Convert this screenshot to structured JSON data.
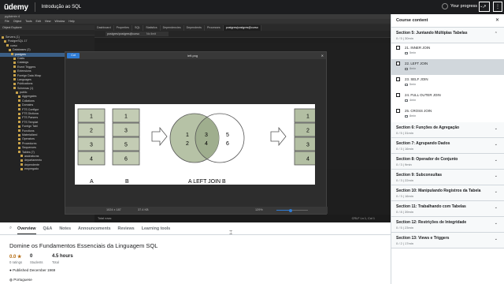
{
  "header": {
    "logo": "ūdemy",
    "course_title": "Introdução ao SQL",
    "progress_label": "Your progress",
    "share_icon": "share-icon",
    "more_icon": "more-icon"
  },
  "pgadmin": {
    "window_title": "pgAdmin 4",
    "menu": [
      "File",
      "Object",
      "Tools",
      "Edit",
      "View",
      "Window",
      "Help"
    ],
    "explorer_title": "Object Explorer",
    "tree": [
      "Servers (1)",
      "PostgreSQL 17",
      "curso",
      "Databases (2)",
      "postgres",
      "Casts",
      "Catalogs",
      "Event Triggers",
      "Extensions",
      "Foreign Data Wrap",
      "Languages",
      "Publications",
      "Schemas (1)",
      "public",
      "Aggregates",
      "Collations",
      "Domains",
      "FTS Configur",
      "FTS Dictiona",
      "FTS Parsers",
      "FTS Templat",
      "Foreign Tabl",
      "Functions",
      "Materialized",
      "Operators",
      "Procedures",
      "Sequences",
      "Tables (7)",
      "assinaturas",
      "departamento",
      "dependente",
      "empregado"
    ],
    "tabs": [
      "Dashboard",
      "Properties",
      "SQL",
      "Statistics",
      "Dependencies",
      "Dependents",
      "Processes",
      "postgres/postgres@curso"
    ],
    "db_selector": "postgres/postgres@curso",
    "no_limit": "No limit",
    "status_left": "Total rows:",
    "status_right": "CRLF    Ln 1, Col 1"
  },
  "viewer": {
    "copy_label": "Cut",
    "file_name": "left.png",
    "dims": "1024 x 187",
    "file_size": "37.4 KB",
    "zoom": "129%",
    "zoom_fraction": 0.45
  },
  "diagram": {
    "table_a": [
      "1",
      "2",
      "3",
      "4"
    ],
    "table_b": [
      "1",
      "3",
      "5",
      "6"
    ],
    "label_a": "A",
    "label_b": "B",
    "venn_left": [
      "1",
      "2"
    ],
    "venn_center": [
      "3",
      "4"
    ],
    "venn_right": [
      "5",
      "6"
    ],
    "venn_label": "A LEFT JOIN B",
    "result": [
      "1",
      "2",
      "3",
      "4"
    ]
  },
  "lower": {
    "tabs": [
      "Overview",
      "Q&A",
      "Notes",
      "Announcements",
      "Reviews",
      "Learning tools"
    ],
    "title": "Domine os Fundamentos Essenciais da Linguagem SQL",
    "rating": "0.0 ★",
    "rating_label": "0 ratings",
    "students": "0",
    "students_label": "Students",
    "hours": "4.5 hours",
    "hours_label": "Total",
    "published": "Published December 1969",
    "language": "Portuguese"
  },
  "sidebar": {
    "title": "Course content",
    "sections": [
      {
        "title": "Section 5: Juntando Múltiplas Tabelas",
        "sub": "0 / 5 | 30min",
        "open": true,
        "lectures": [
          {
            "title": "21. INNER JOIN",
            "dur": "5min",
            "current": false
          },
          {
            "title": "22. LEFT JOIN",
            "dur": "8min",
            "current": true
          },
          {
            "title": "23. SELF JOIN",
            "dur": "5min",
            "current": false
          },
          {
            "title": "24. FULL OUTER JOIN",
            "dur": "4min",
            "current": false
          },
          {
            "title": "25. CROSS JOIN",
            "dur": "8min",
            "current": false
          }
        ]
      },
      {
        "title": "Section 6: Funções de Agregação",
        "sub": "0 / 5 | 31min"
      },
      {
        "title": "Section 7: Agrupando Dados",
        "sub": "0 / 3 | 16min"
      },
      {
        "title": "Section 8: Operador de Conjunto",
        "sub": "0 / 3 | 9min"
      },
      {
        "title": "Section 9: Subconsultas",
        "sub": "0 / 3 | 22min"
      },
      {
        "title": "Section 10: Manipulando Registros da Tabela",
        "sub": "0 / 3 | 16min"
      },
      {
        "title": "Section 11: Trabalhando com Tabelas",
        "sub": "0 / 8 | 39min"
      },
      {
        "title": "Section 12: Restrições de Integridade",
        "sub": "0 / 5 | 23min"
      },
      {
        "title": "Section 13: Views e Triggers",
        "sub": "0 / 2 | 17min"
      }
    ]
  }
}
